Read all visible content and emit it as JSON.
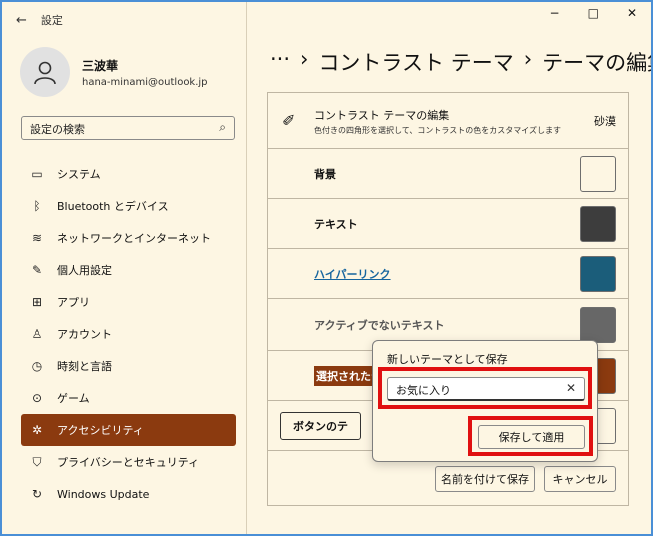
{
  "window": {
    "title": "設定",
    "controls": {
      "minimize": "−",
      "maximize": "□",
      "close": "✕"
    }
  },
  "profile": {
    "name": "三波華",
    "email": "hana-minami@outlook.jp"
  },
  "search": {
    "value": "設定の検索"
  },
  "sidebar": {
    "items": [
      {
        "label": "システム",
        "icon": "monitor-icon",
        "active": false
      },
      {
        "label": "Bluetooth とデバイス",
        "icon": "bluetooth-icon",
        "active": false
      },
      {
        "label": "ネットワークとインターネット",
        "icon": "wifi-icon",
        "active": false
      },
      {
        "label": "個人用設定",
        "icon": "brush-icon",
        "active": false
      },
      {
        "label": "アプリ",
        "icon": "apps-icon",
        "active": false
      },
      {
        "label": "アカウント",
        "icon": "person-icon",
        "active": false
      },
      {
        "label": "時刻と言語",
        "icon": "clock-language-icon",
        "active": false
      },
      {
        "label": "ゲーム",
        "icon": "gamepad-icon",
        "active": false
      },
      {
        "label": "アクセシビリティ",
        "icon": "accessibility-icon",
        "active": true
      },
      {
        "label": "プライバシーとセキュリティ",
        "icon": "shield-icon",
        "active": false
      },
      {
        "label": "Windows Update",
        "icon": "update-icon",
        "active": false
      }
    ]
  },
  "breadcrumb": {
    "ellipsis": "···",
    "sep": "›",
    "item1": "コントラスト テーマ",
    "item2": "テーマの編集"
  },
  "editor": {
    "header_title": "コントラスト テーマの編集",
    "header_sub": "色付きの四角形を選択して、コントラストの色をカスタマイズします",
    "theme_name": "砂漠",
    "rows": [
      {
        "label": "背景",
        "color": "#fdf6e3"
      },
      {
        "label": "テキスト",
        "color": "#3d3d3d"
      },
      {
        "label": "ハイパーリンク",
        "color": "#1b5d7a"
      },
      {
        "label": "アクティブでないテキスト",
        "color": "#676767"
      },
      {
        "label": "選択されたテ",
        "color": "#8b3a0f"
      },
      {
        "label": "ボタンのテ",
        "color": "#fdf6e3"
      }
    ],
    "save_as_label": "名前を付けて保存",
    "cancel_label": "キャンセル"
  },
  "dialog": {
    "title": "新しいテーマとして保存",
    "input_value": "お気に入り",
    "clear_icon": "✕",
    "apply_label": "保存して適用"
  },
  "colors": {
    "accent": "#8b3a0f",
    "highlight": "#e01010",
    "background": "#fdf6e3"
  }
}
